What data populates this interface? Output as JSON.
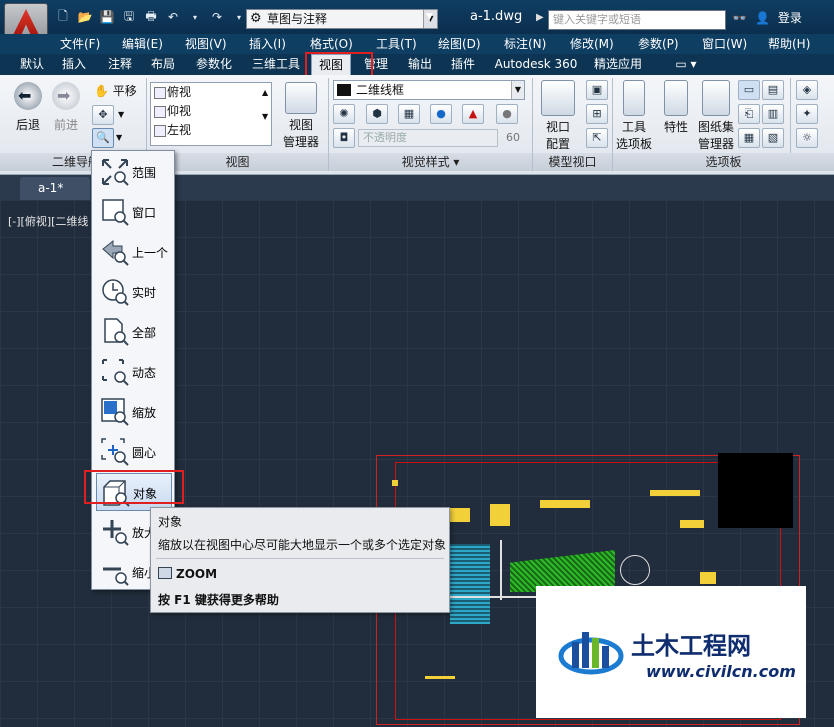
{
  "title_bar": {
    "workspace": "草图与注释",
    "doc_title": "a-1.dwg",
    "search_placeholder": "键入关键字或短语",
    "login": "登录"
  },
  "menu": [
    "文件(F)",
    "编辑(E)",
    "视图(V)",
    "插入(I)",
    "格式(O)",
    "工具(T)",
    "绘图(D)",
    "标注(N)",
    "修改(M)",
    "参数(P)",
    "窗口(W)",
    "帮助(H)"
  ],
  "tabs": [
    "默认",
    "插入",
    "注释",
    "布局",
    "参数化",
    "三维工具",
    "视图",
    "管理",
    "输出",
    "插件",
    "Autodesk 360",
    "精选应用"
  ],
  "active_tab": "视图",
  "ribbon": {
    "nav": {
      "back": "后退",
      "forward": "前进",
      "pan": "平移",
      "label": "二维导航"
    },
    "views": {
      "items": [
        "俯视",
        "仰视",
        "左视"
      ],
      "manager_l1": "视图",
      "manager_l2": "管理器",
      "label": "视图"
    },
    "visual": {
      "style": "二维线框",
      "opacity": "不透明度",
      "opacity_val": "60",
      "label": "视觉样式"
    },
    "viewport": {
      "l1": "视口",
      "l2": "配置",
      "label": "模型视口"
    },
    "palettes": {
      "tool_l1": "工具",
      "tool_l2": "选项板",
      "props": "特性",
      "sheet_l1": "图纸集",
      "sheet_l2": "管理器",
      "label": "选项板"
    }
  },
  "doc_tab": "a-1*",
  "viewport_label": "[-][俯视][二维线",
  "zoom_menu": [
    "范围",
    "窗口",
    "上一个",
    "实时",
    "全部",
    "动态",
    "缩放",
    "圆心",
    "对象",
    "放大",
    "缩小"
  ],
  "selected_zoom": "对象",
  "tooltip": {
    "title": "对象",
    "desc": "缩放以在视图中心尽可能大地显示一个或多个选定对象",
    "command": "ZOOM",
    "help": "按 F1 键获得更多帮助"
  },
  "watermark": {
    "name": "土木工程网",
    "url": "www.civilcn.com"
  }
}
